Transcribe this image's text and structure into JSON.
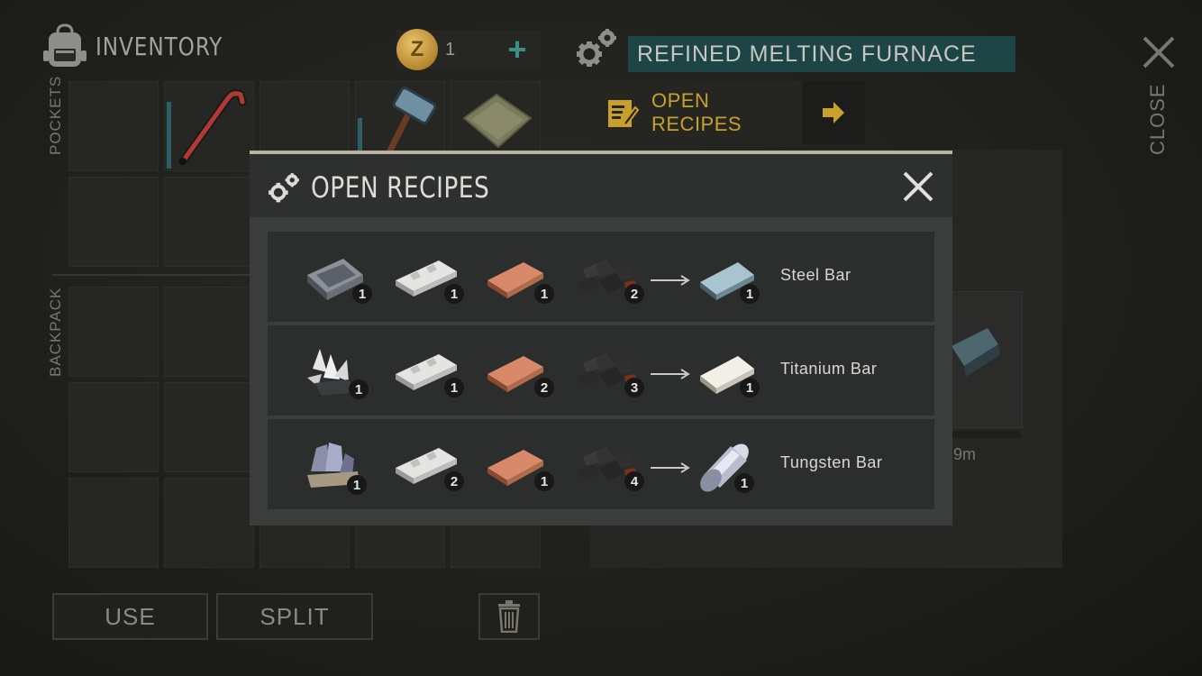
{
  "inventory": {
    "title": "INVENTORY",
    "coins": "1",
    "coin_glyph": "Z",
    "coin_plus": "+",
    "pockets_label": "POCKETS",
    "backpack_label": "BACKPACK",
    "use_label": "USE",
    "split_label": "SPLIT"
  },
  "furnace": {
    "title": "REFINED MELTING FURNACE",
    "open_recipes_label": "OPEN RECIPES",
    "timer": "9m",
    "close_label": "CLOSE"
  },
  "modal": {
    "title": "OPEN RECIPES",
    "recipes": [
      {
        "name": "Steel Bar",
        "ingredients": [
          {
            "icon": "iron-ingot-icon",
            "qty": "1"
          },
          {
            "icon": "aluminum-ingot-icon",
            "qty": "1"
          },
          {
            "icon": "copper-ingot-icon",
            "qty": "1"
          },
          {
            "icon": "coal-icon",
            "qty": "2"
          }
        ],
        "result": {
          "icon": "steel-bar-icon",
          "qty": "1"
        }
      },
      {
        "name": "Titanium Bar",
        "ingredients": [
          {
            "icon": "titanium-ore-icon",
            "qty": "1"
          },
          {
            "icon": "aluminum-ingot-icon",
            "qty": "1"
          },
          {
            "icon": "copper-ingot-icon",
            "qty": "2"
          },
          {
            "icon": "coal-icon",
            "qty": "3"
          }
        ],
        "result": {
          "icon": "titanium-bar-icon",
          "qty": "1"
        }
      },
      {
        "name": "Tungsten Bar",
        "ingredients": [
          {
            "icon": "tungsten-ore-icon",
            "qty": "1"
          },
          {
            "icon": "aluminum-ingot-icon",
            "qty": "2"
          },
          {
            "icon": "copper-ingot-icon",
            "qty": "1"
          },
          {
            "icon": "coal-icon",
            "qty": "4"
          }
        ],
        "result": {
          "icon": "tungsten-bar-icon",
          "qty": "1"
        }
      }
    ]
  },
  "colors": {
    "accent_teal": "#1e4545",
    "accent_gold": "#c9a02b",
    "modal_border": "#b9b49e"
  }
}
